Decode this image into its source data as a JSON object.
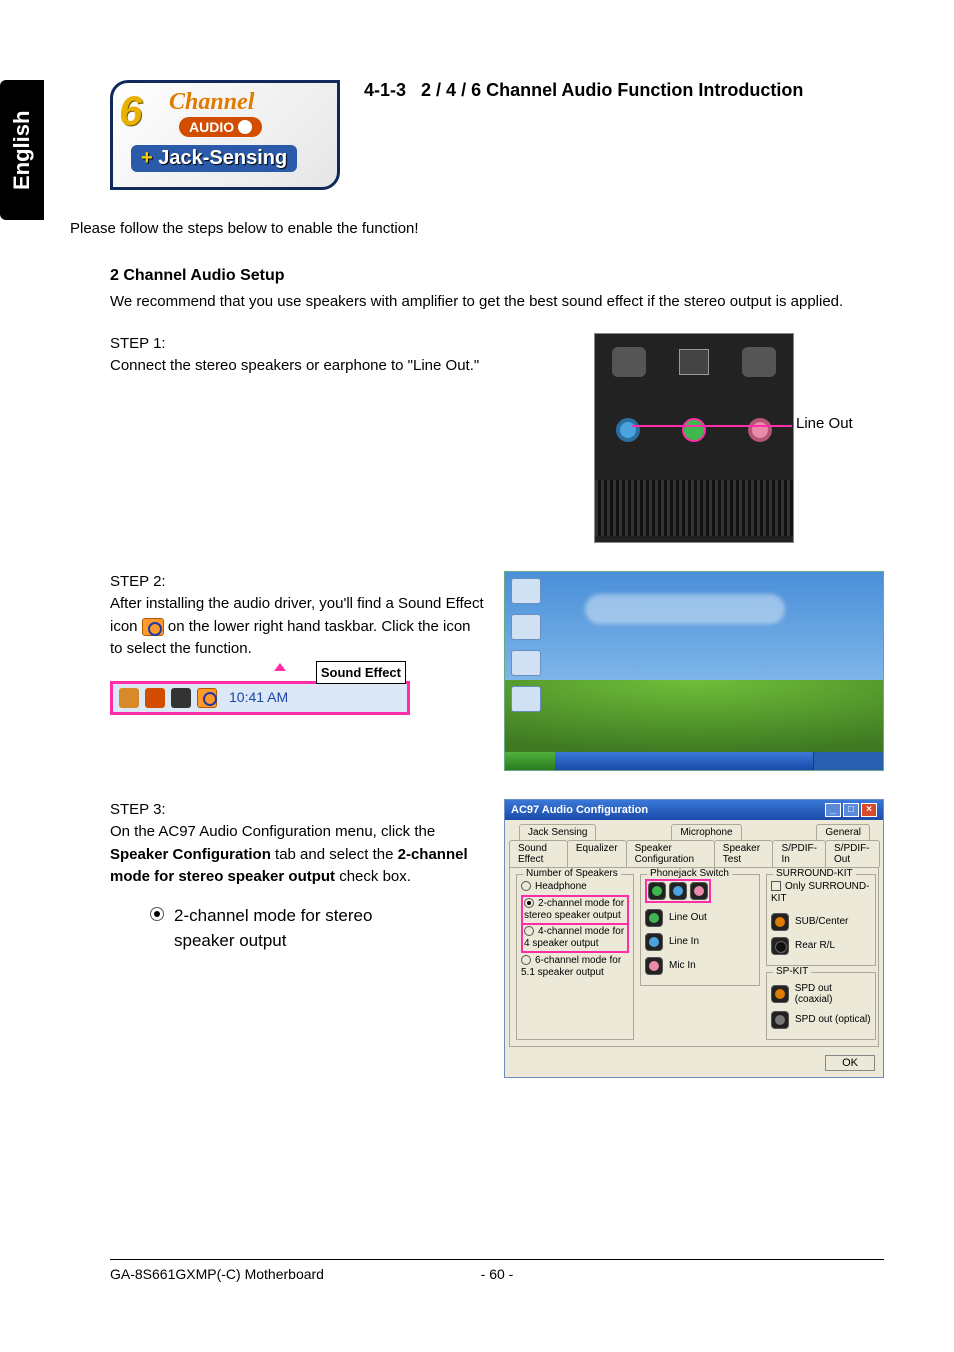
{
  "language_tab": "English",
  "section": {
    "number": "4-1-3",
    "title": "2 / 4 / 6 Channel Audio Function Introduction"
  },
  "logo": {
    "six": "6",
    "channel": "Channel",
    "audio": "AUDIO",
    "jack_plus": "+",
    "jack": "Jack-Sensing"
  },
  "intro": "Please follow the steps below to enable the function!",
  "setup_heading": "2 Channel Audio Setup",
  "setup_body": "We recommend that you use speakers with amplifier to get the best sound effect if the stereo output is applied.",
  "step1": {
    "label": "STEP 1:",
    "text": "Connect the stereo speakers or earphone to \"Line Out.\"",
    "lineout_label": "Line Out"
  },
  "step2": {
    "label": "STEP 2:",
    "text_before_icon": "After installing the audio driver, you'll find a Sound Effect  icon ",
    "text_after_icon": " on the lower right hand taskbar. Click the icon to select the function.",
    "tooltip": "Sound Effect",
    "time": "10:41 AM"
  },
  "step3": {
    "label": "STEP 3:",
    "text_1": "On the AC97 Audio Configuration menu, click the ",
    "bold_1": "Speaker Configuration",
    "text_2": " tab and select the ",
    "bold_2": "2-channel mode for stereo speaker output",
    "text_3": " check box.",
    "check_label": "2-channel mode for stereo\nspeaker output"
  },
  "ac97": {
    "title": "AC97 Audio Configuration",
    "tabs_row1": [
      "Jack Sensing",
      "Microphone",
      "General"
    ],
    "tabs_row2": [
      "Sound Effect",
      "Equalizer",
      "Speaker Configuration",
      "Speaker Test",
      "S/PDIF-In",
      "S/PDIF-Out"
    ],
    "grp_speakers": "Number of Speakers",
    "grp_phonejack": "Phonejack Switch",
    "grp_surround": "SURROUND-KIT",
    "grp_spkit": "SP-KIT",
    "only_surround": "Only SURROUND-KIT",
    "opts": {
      "headphone": "Headphone",
      "two": "2-channel mode for stereo speaker output",
      "four": "4-channel mode for 4 speaker output",
      "six": "6-channel mode for 5.1 speaker output"
    },
    "jacks": {
      "lineout": "Line Out",
      "linein": "Line In",
      "micin": "Mic In",
      "subcenter": "SUB/Center",
      "rear": "Rear R/L",
      "coax": "SPD out (coaxial)",
      "opt": "SPD out (optical)"
    },
    "ok": "OK"
  },
  "footer": {
    "product": "GA-8S661GXMP(-C) Motherboard",
    "page": "- 60 -"
  }
}
